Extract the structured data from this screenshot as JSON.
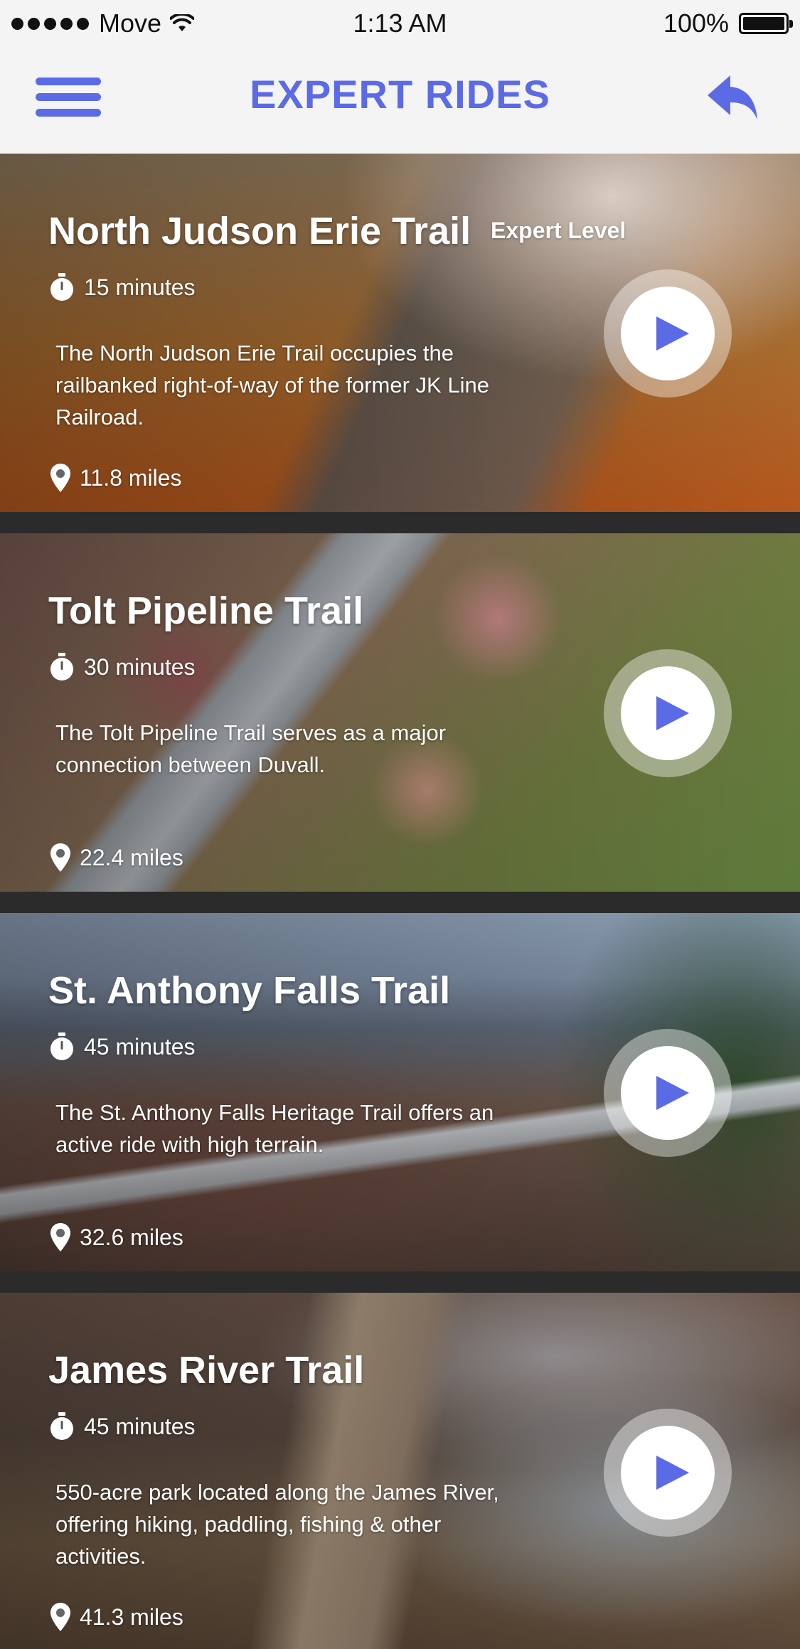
{
  "status_bar": {
    "carrier": "Move",
    "time": "1:13 AM",
    "battery": "100%"
  },
  "header": {
    "title": "EXPERT RIDES",
    "menu_icon": "hamburger-menu-icon",
    "back_icon": "reply-arrow-icon"
  },
  "colors": {
    "accent": "#5b6be6",
    "background": "#f4f4f4",
    "divider": "#2b2b2b"
  },
  "trails": [
    {
      "name": "North Judson Erie Trail",
      "level": "Expert  Level",
      "duration": "15 minutes",
      "description": "The North Judson Erie Trail occupies the railbanked right-of-way of the former JK Line Railroad.",
      "distance": "11.8 miles"
    },
    {
      "name": "Tolt Pipeline Trail",
      "duration": "30 minutes",
      "description": "The Tolt Pipeline Trail serves as a major connection between Duvall.",
      "distance": "22.4 miles"
    },
    {
      "name": "St. Anthony Falls Trail",
      "duration": "45 minutes",
      "description": "The St. Anthony Falls Heritage Trail offers an active ride with high terrain.",
      "distance": "32.6 miles"
    },
    {
      "name": "James River Trail",
      "duration": "45 minutes",
      "description": "550-acre park located along the James River, offering hiking, paddling, fishing & other activities.",
      "distance": "41.3 miles"
    }
  ]
}
